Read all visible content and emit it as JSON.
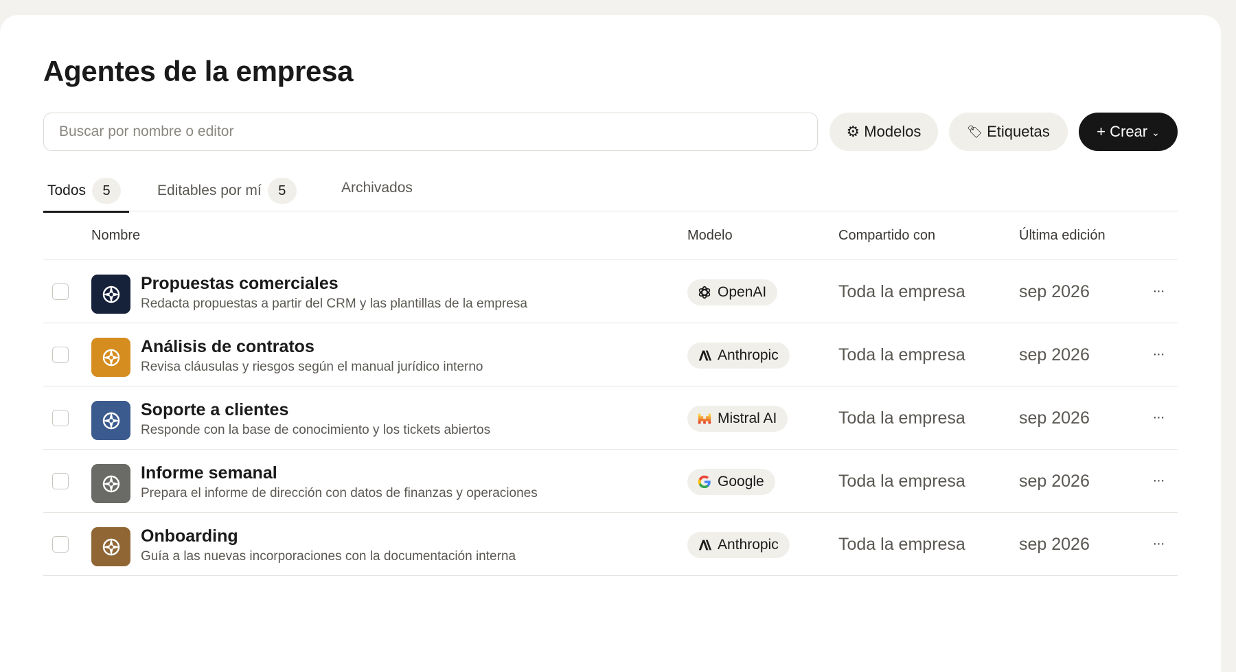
{
  "page": {
    "title": "Agentes de la empresa"
  },
  "search": {
    "placeholder": "Buscar por nombre o editor",
    "value": ""
  },
  "toolbar": {
    "models_icon": "⚙",
    "models_label": "Modelos",
    "tags_icon": "🏷",
    "tags_label": "Etiquetas",
    "create_label": "+ Crear",
    "create_chevron": "⌄"
  },
  "tabs": [
    {
      "label": "Todos",
      "count": "5",
      "active": true
    },
    {
      "label": "Editables por mí",
      "count": "5",
      "active": false
    },
    {
      "label": "Archivados",
      "active": false
    }
  ],
  "table": {
    "columns": {
      "name": "Nombre",
      "model": "Modelo",
      "shared": "Compartido con",
      "edited": "Última edición"
    },
    "rows": [
      {
        "name": "Propuestas comerciales",
        "description": "Redacta propuestas a partir del CRM y las plantillas de la empresa",
        "avatar_color": "#16213a",
        "model": "OpenAI",
        "model_icon": "openai-logo-icon",
        "shared": "Toda la empresa",
        "edited": "sep 2026",
        "more": "···"
      },
      {
        "name": "Análisis de contratos",
        "description": "Revisa cláusulas y riesgos según el manual jurídico interno",
        "avatar_color": "#d58d1f",
        "model": "Anthropic",
        "model_icon": "anthropic-logo-icon",
        "shared": "Toda la empresa",
        "edited": "sep 2026",
        "more": "···"
      },
      {
        "name": "Soporte a clientes",
        "description": "Responde con la base de conocimiento y los tickets abiertos",
        "avatar_color": "#3b5b8e",
        "model": "Mistral AI",
        "model_icon": "mistral-logo-icon",
        "shared": "Toda la empresa",
        "edited": "sep 2026",
        "more": "···"
      },
      {
        "name": "Informe semanal",
        "description": "Prepara el informe de dirección con datos de finanzas y operaciones",
        "avatar_color": "#6a6a66",
        "model": "Google",
        "model_icon": "google-logo-icon",
        "shared": "Toda la empresa",
        "edited": "sep 2026",
        "more": "···"
      },
      {
        "name": "Onboarding",
        "description": "Guía a las nuevas incorporaciones con la documentación interna",
        "avatar_color": "#8f6634",
        "model": "Anthropic",
        "model_icon": "anthropic-logo-icon",
        "shared": "Toda la empresa",
        "edited": "sep 2026",
        "more": "···"
      }
    ]
  }
}
